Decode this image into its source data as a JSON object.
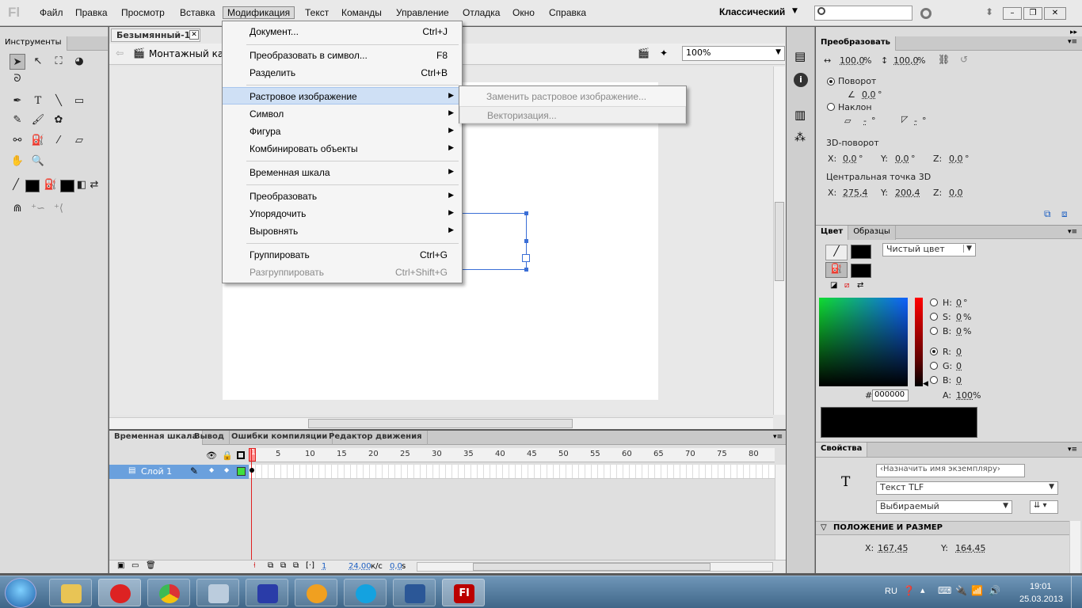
{
  "app": {
    "logo": "Fl",
    "workspace": "Классический"
  },
  "menubar": [
    "Файл",
    "Правка",
    "Просмотр",
    "Вставка",
    "Модификация",
    "Текст",
    "Команды",
    "Управление",
    "Отладка",
    "Окно",
    "Справка"
  ],
  "tools_panel": {
    "title": "Инструменты"
  },
  "document": {
    "tab": "Безымянный-1*",
    "scene": "Монтажный кадр",
    "zoom": "100%"
  },
  "modify_menu": {
    "items": [
      {
        "label": "Документ...",
        "shortcut": "Ctrl+J"
      },
      {
        "label": "Преобразовать в символ...",
        "shortcut": "F8"
      },
      {
        "label": "Разделить",
        "shortcut": "Ctrl+B"
      },
      {
        "label": "Растровое изображение",
        "shortcut": ""
      },
      {
        "label": "Символ",
        "shortcut": ""
      },
      {
        "label": "Фигура",
        "shortcut": ""
      },
      {
        "label": "Комбинировать объекты",
        "shortcut": ""
      },
      {
        "label": "Временная шкала",
        "shortcut": ""
      },
      {
        "label": "Преобразовать",
        "shortcut": ""
      },
      {
        "label": "Упорядочить",
        "shortcut": ""
      },
      {
        "label": "Выровнять",
        "shortcut": ""
      },
      {
        "label": "Группировать",
        "shortcut": "Ctrl+G"
      },
      {
        "label": "Разгруппировать",
        "shortcut": "Ctrl+Shift+G"
      }
    ],
    "submenu": [
      "Заменить растровое изображение...",
      "Векторизация..."
    ]
  },
  "timeline": {
    "tabs": [
      "Временная шкала",
      "Вывод",
      "Ошибки компиляции",
      "Редактор движения"
    ],
    "frame_numbers": [
      "1",
      "5",
      "10",
      "15",
      "20",
      "25",
      "30",
      "35",
      "40",
      "45",
      "50",
      "55",
      "60",
      "65",
      "70",
      "75",
      "80"
    ],
    "layer": "Слой 1",
    "current_frame": "1",
    "fps": "24,00",
    "fps_unit": "к/с",
    "time": "0,0",
    "time_unit": "s"
  },
  "transform": {
    "title": "Преобразовать",
    "width": "100,0",
    "height": "100,0",
    "pct": "%",
    "rotate_label": "Поворот",
    "rotate_value": "0,0",
    "skew_label": "Наклон",
    "skew_h": "-",
    "skew_v": "-",
    "deg": "°",
    "rot3d_label": "3D-поворот",
    "rx": "0,0",
    "ry": "0,0",
    "rz": "0,0",
    "center3d_label": "Центральная точка 3D",
    "cx": "275,4",
    "cy": "200,4",
    "cz": "0,0",
    "x_label": "X:",
    "y_label": "Y:",
    "z_label": "Z:"
  },
  "color": {
    "tabs": [
      "Цвет",
      "Образцы"
    ],
    "fill_type": "Чистый цвет",
    "h": "0",
    "s": "0",
    "b": "0",
    "r": "0",
    "g": "0",
    "b2": "0",
    "hex_label": "#",
    "hex": "000000",
    "alpha": "100",
    "h_label": "H:",
    "s_label": "S:",
    "b_label": "B:",
    "r_label": "R:",
    "g_label": "G:",
    "bb_label": "B:",
    "a_label": "A:",
    "deg": "°",
    "pct": "%"
  },
  "properties": {
    "title": "Свойства",
    "type_icon": "T",
    "instance_placeholder": "‹Назначить имя экземпляру›",
    "text_engine": "Текст TLF",
    "behavior": "Выбираемый",
    "section": "ПОЛОЖЕНИЕ И РАЗМЕР",
    "x_label": "X:",
    "x": "167,45",
    "y_label": "Y:",
    "y": "164,45"
  },
  "taskbar": {
    "language": "RU",
    "time": "19:01",
    "date": "25.03.2013"
  }
}
